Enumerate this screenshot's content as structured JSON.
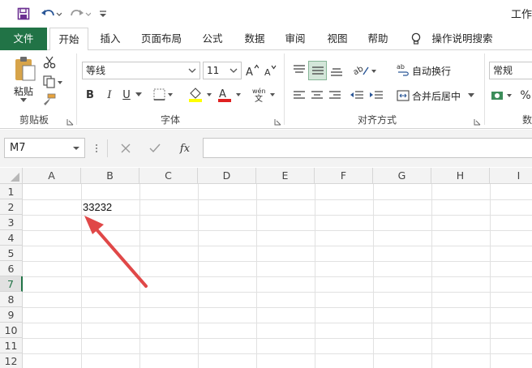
{
  "qat": {
    "icons": [
      "save-icon",
      "undo-icon",
      "redo-icon",
      "customize-icon"
    ],
    "title": "工作"
  },
  "tabs": [
    "文件",
    "开始",
    "插入",
    "页面布局",
    "公式",
    "数据",
    "审阅",
    "视图",
    "帮助"
  ],
  "tell_me": "操作说明搜索",
  "ribbon": {
    "clipboard": {
      "paste_label": "粘贴",
      "group_label": "剪贴板"
    },
    "font": {
      "font_name": "等线",
      "font_size": "11",
      "bold": "B",
      "italic": "I",
      "underline": "U",
      "phonetic": "wén",
      "group_label": "字体"
    },
    "alignment": {
      "wrap_text": "自动换行",
      "merge_center": "合并后居中",
      "group_label": "对齐方式"
    },
    "number": {
      "format": "常规",
      "percent": "%",
      "group_label": "数"
    }
  },
  "formula_bar": {
    "name_box": "M7",
    "fx_label": "fx",
    "value": ""
  },
  "grid": {
    "columns": [
      "A",
      "B",
      "C",
      "D",
      "E",
      "F",
      "G",
      "H",
      "I"
    ],
    "rows": [
      "1",
      "2",
      "3",
      "4",
      "5",
      "6",
      "7",
      "8",
      "9",
      "10",
      "11",
      "12"
    ],
    "selected_row": "7",
    "cells": {
      "B2": "33232"
    }
  },
  "colors": {
    "excel_green": "#217346",
    "arrow_red": "#e04848"
  }
}
